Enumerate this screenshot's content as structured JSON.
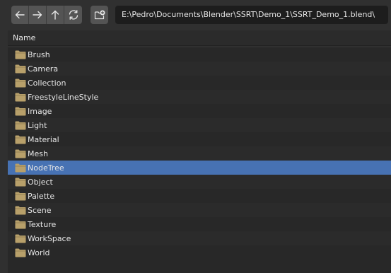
{
  "toolbar": {
    "nav_buttons": [
      {
        "name": "back",
        "icon": "arrow-left-icon"
      },
      {
        "name": "forward",
        "icon": "arrow-right-icon"
      },
      {
        "name": "parent",
        "icon": "arrow-up-icon"
      },
      {
        "name": "refresh",
        "icon": "refresh-icon"
      }
    ],
    "new_directory_icon": "new-folder-icon",
    "path": "E:\\Pedro\\Documents\\Blender\\SSRT\\Demo_1\\SSRT_Demo_1.blend\\"
  },
  "header": {
    "name_column": "Name"
  },
  "files": [
    {
      "label": "Brush",
      "selected": false
    },
    {
      "label": "Camera",
      "selected": false
    },
    {
      "label": "Collection",
      "selected": false
    },
    {
      "label": "FreestyleLineStyle",
      "selected": false
    },
    {
      "label": "Image",
      "selected": false
    },
    {
      "label": "Light",
      "selected": false
    },
    {
      "label": "Material",
      "selected": false
    },
    {
      "label": "Mesh",
      "selected": false
    },
    {
      "label": "NodeTree",
      "selected": true
    },
    {
      "label": "Object",
      "selected": false
    },
    {
      "label": "Palette",
      "selected": false
    },
    {
      "label": "Scene",
      "selected": false
    },
    {
      "label": "Texture",
      "selected": false
    },
    {
      "label": "WorkSpace",
      "selected": false
    },
    {
      "label": "World",
      "selected": false
    }
  ],
  "colors": {
    "background": "#303030",
    "row_odd": "#282828",
    "row_even": "#2b2b2b",
    "selected": "#4772b3",
    "button": "#545454",
    "path_field": "#1d1d1d",
    "folder": "#b8a06a"
  }
}
